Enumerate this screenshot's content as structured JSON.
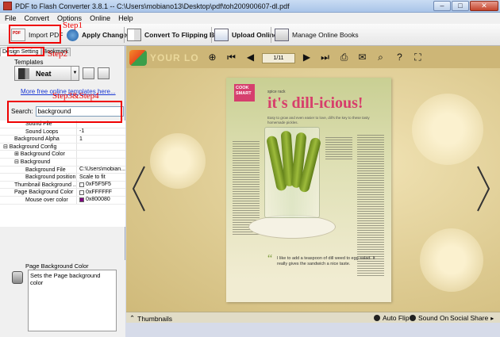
{
  "window": {
    "title": "PDF to Flash Converter 3.8.1  -- C:\\Users\\mobiano13\\Desktop\\pdf\\toh200900607-dl.pdf",
    "minimize": "–",
    "maximize": "□",
    "close": "✕"
  },
  "menu": [
    "File",
    "Convert",
    "Options",
    "Online",
    "Help"
  ],
  "toolbar": {
    "import_pdf": "Import PDF",
    "apply_change": "Apply Change",
    "convert_flipping": "Convert To Flipping Book",
    "upload_online": "Upload Online",
    "manage_online": "Manage Online Books"
  },
  "annotations": {
    "step1": "Step1",
    "step2": "Step2",
    "step34": "Step3&Step4"
  },
  "left": {
    "tabs": [
      "Design Setting",
      "Bookmark"
    ],
    "templates_label": "Templates",
    "template_name": "Neat",
    "more_templates": "More free online templates here...",
    "search_label": "Search:",
    "search_value": "background"
  },
  "properties": [
    {
      "k": "Sound File",
      "v": "",
      "indent": 2
    },
    {
      "k": "Sound Loops",
      "v": "-1",
      "indent": 2
    },
    {
      "k": "Background Alpha",
      "v": "1",
      "indent": 1
    },
    {
      "k": "⊟ Background Config",
      "v": "",
      "indent": 0
    },
    {
      "k": "⊞ Background Color",
      "v": "",
      "indent": 1
    },
    {
      "k": "⊟ Background",
      "v": "",
      "indent": 1
    },
    {
      "k": "Background File",
      "v": "C:\\Users\\mobian...",
      "indent": 2
    },
    {
      "k": "Background position",
      "v": "Scale to fit",
      "indent": 2
    },
    {
      "k": "Thumbnail Background ...",
      "v": "0xF5F5F5",
      "indent": 1,
      "swatch": "#F5F5F5"
    },
    {
      "k": "Page Background Color",
      "v": "0xFFFFFF",
      "indent": 1,
      "swatch": "#FFFFFF"
    },
    {
      "k": "Mouse over color",
      "v": "0x800080",
      "indent": 2,
      "swatch": "#800080"
    }
  ],
  "description": {
    "title": "Page Background Color",
    "text": "Sets the Page background color"
  },
  "viewer": {
    "logo_text": "YOUR LO",
    "page_indicator": "1/11",
    "magazine": {
      "badge": "COOK SMART",
      "kicker": "spice rack",
      "title": "it's dill-icious!",
      "dek": "Easy to grow and even easier to love, dill's the key to these tasty homemade pickles.",
      "quote": "I like to add a teaspoon of dill weed to egg salad. It really gives the sandwich a nice taste."
    },
    "status": {
      "thumbnails": "Thumbnails",
      "auto_flip": "Auto Flip",
      "sound_on": "Sound On",
      "social_share": "Social Share"
    }
  },
  "colors": {
    "annotation_red": "#e00000",
    "viewer_bg": "#d9c68e",
    "title_pink": "#d73e6b",
    "link_blue": "#1a39d4"
  }
}
